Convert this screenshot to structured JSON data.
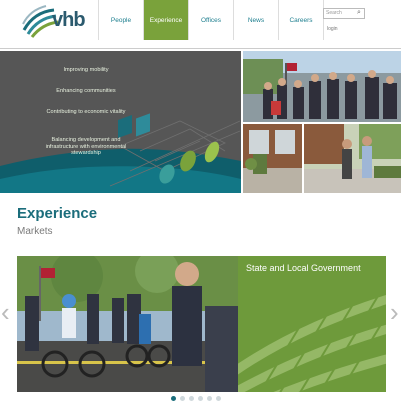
{
  "header": {
    "logo_text": "vhb",
    "nav": [
      "People",
      "Experience",
      "Offices",
      "News",
      "Careers"
    ],
    "search_placeholder": "Search",
    "login": "login"
  },
  "hero": {
    "lines": [
      "Improving mobility",
      "Enhancing communities",
      "Contributing to economic vitality",
      "Balancing development and infrastructure with environmental stewardship"
    ]
  },
  "section": {
    "title": "Experience",
    "subtitle": "Markets"
  },
  "slide": {
    "title": "State and Local Government"
  },
  "carousel": {
    "left_arrow": "‹",
    "right_arrow": "›"
  },
  "colors": {
    "brand_teal": "#1b6d7b",
    "accent_green": "#7aa23b",
    "hero_gray": "#565656",
    "panel_green": "#6e9a3b"
  }
}
